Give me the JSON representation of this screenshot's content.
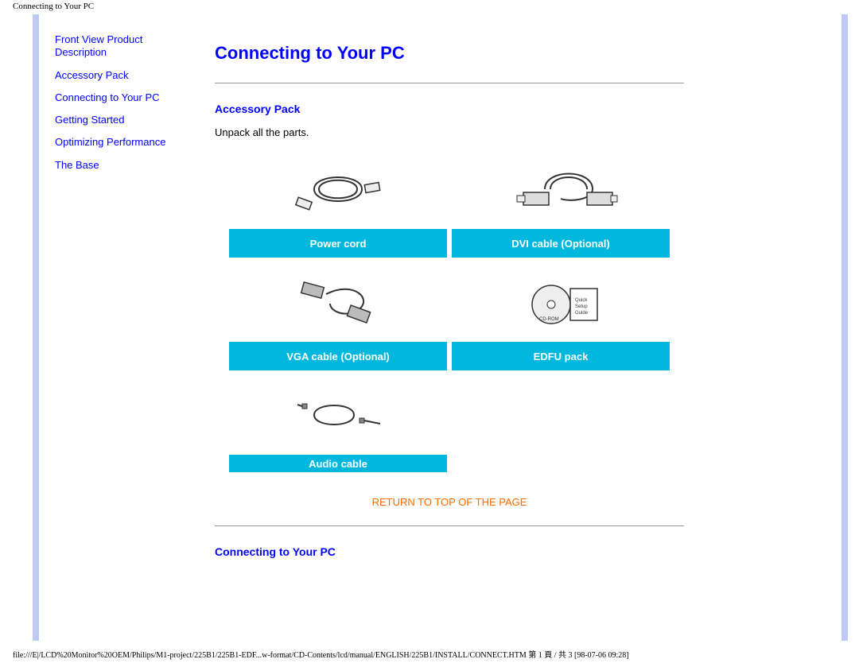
{
  "header": {
    "running_title": "Connecting to Your PC"
  },
  "sidebar": {
    "items": [
      "Front View Product Description",
      "Accessory Pack",
      "Connecting to Your PC",
      "Getting Started",
      "Optimizing Performance",
      "The Base"
    ]
  },
  "content": {
    "title": "Connecting to Your PC",
    "sections": [
      {
        "heading": "Accessory Pack",
        "text": "Unpack all the parts."
      },
      {
        "heading": "Connecting to Your PC"
      }
    ],
    "accessories": [
      {
        "label": "Power cord"
      },
      {
        "label": "DVI cable (Optional)"
      },
      {
        "label": "VGA cable (Optional)"
      },
      {
        "label": "EDFU pack"
      },
      {
        "label": "Audio cable"
      }
    ],
    "return_link": "RETURN TO TOP OF THE PAGE"
  },
  "footer": {
    "text": "file:///E|/LCD%20Monitor%20OEM/Philips/M1-project/225B1/225B1-EDF...w-format/CD-Contents/lcd/manual/ENGLISH/225B1/INSTALL/CONNECT.HTM 第 1 頁 / 共 3  [98-07-06 09:28]"
  },
  "colors": {
    "link_blue": "#0000ff",
    "accent_bar": "#bfcaf5",
    "label_bg": "#00b8dd",
    "return_orange": "#ff6a00"
  }
}
